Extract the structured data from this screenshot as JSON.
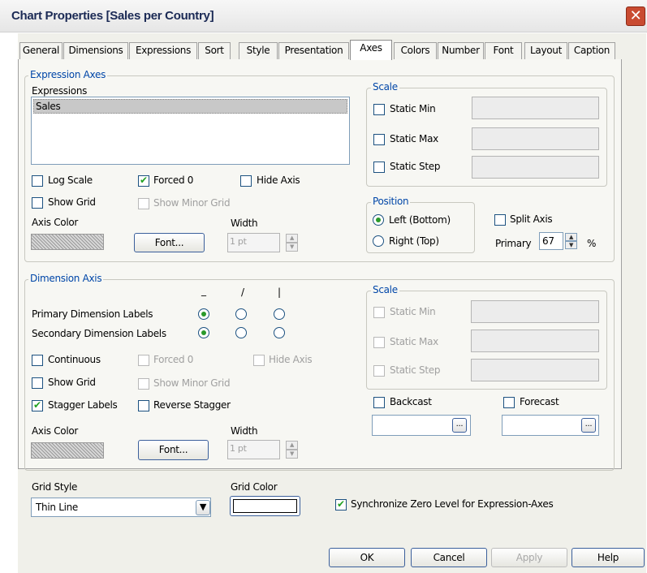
{
  "window": {
    "title": "Chart Properties [Sales per Country]",
    "close_glyph": "✕"
  },
  "tabs": [
    "General",
    "Dimensions",
    "Expressions",
    "Sort",
    "Style",
    "Presentation",
    "Axes",
    "Colors",
    "Number",
    "Font",
    "Layout",
    "Caption"
  ],
  "active_tab": "Axes",
  "expression_axes": {
    "legend": "Expression Axes",
    "list_label": "Expressions",
    "list_items": [
      "Sales"
    ],
    "log_scale": {
      "label": "Log Scale",
      "checked": false
    },
    "forced_0": {
      "label": "Forced 0",
      "checked": true
    },
    "hide_axis": {
      "label": "Hide Axis",
      "checked": false
    },
    "show_grid": {
      "label": "Show Grid",
      "checked": false
    },
    "show_minor_grid": {
      "label": "Show Minor Grid",
      "checked": false
    },
    "axis_color_label": "Axis Color",
    "font_button": "Font...",
    "width_label": "Width",
    "width_value": "1 pt",
    "scale": {
      "legend": "Scale",
      "static_min": "Static Min",
      "static_max": "Static Max",
      "static_step": "Static Step"
    },
    "position": {
      "legend": "Position",
      "left_bottom": "Left (Bottom)",
      "right_top": "Right (Top)",
      "selected": "left_bottom"
    },
    "split_axis": {
      "label": "Split Axis",
      "checked": false
    },
    "primary_label": "Primary",
    "primary_value": "67",
    "percent": "%"
  },
  "dimension_axis": {
    "legend": "Dimension Axis",
    "orientation_headers": [
      "_",
      "/",
      "|"
    ],
    "primary_labels": "Primary Dimension Labels",
    "secondary_labels": "Secondary Dimension Labels",
    "primary_selected": 0,
    "secondary_selected": 0,
    "continuous": {
      "label": "Continuous",
      "checked": false
    },
    "forced_0": {
      "label": "Forced 0",
      "checked": false
    },
    "hide_axis": {
      "label": "Hide Axis",
      "checked": false
    },
    "show_grid": {
      "label": "Show Grid",
      "checked": false
    },
    "show_minor_grid": {
      "label": "Show Minor Grid",
      "checked": false
    },
    "stagger_labels": {
      "label": "Stagger Labels",
      "checked": true
    },
    "reverse_stagger": {
      "label": "Reverse Stagger",
      "checked": false
    },
    "axis_color_label": "Axis Color",
    "font_button": "Font...",
    "width_label": "Width",
    "width_value": "1 pt",
    "scale": {
      "legend": "Scale",
      "static_min": "Static Min",
      "static_max": "Static Max",
      "static_step": "Static Step"
    },
    "backcast": {
      "label": "Backcast",
      "checked": false
    },
    "forecast": {
      "label": "Forecast",
      "checked": false
    },
    "ellipsis": "..."
  },
  "grid": {
    "style_label": "Grid Style",
    "style_value": "Thin Line",
    "color_label": "Grid Color",
    "sync_zero": {
      "label": "Synchronize Zero Level for Expression-Axes",
      "checked": true
    }
  },
  "buttons": {
    "ok": "OK",
    "cancel": "Cancel",
    "apply": "Apply",
    "help": "Help"
  },
  "colors": {
    "title_text": "#1b2a55",
    "legend_text": "#0046a8",
    "check_green": "#21a121",
    "close_red": "#c94b31"
  }
}
